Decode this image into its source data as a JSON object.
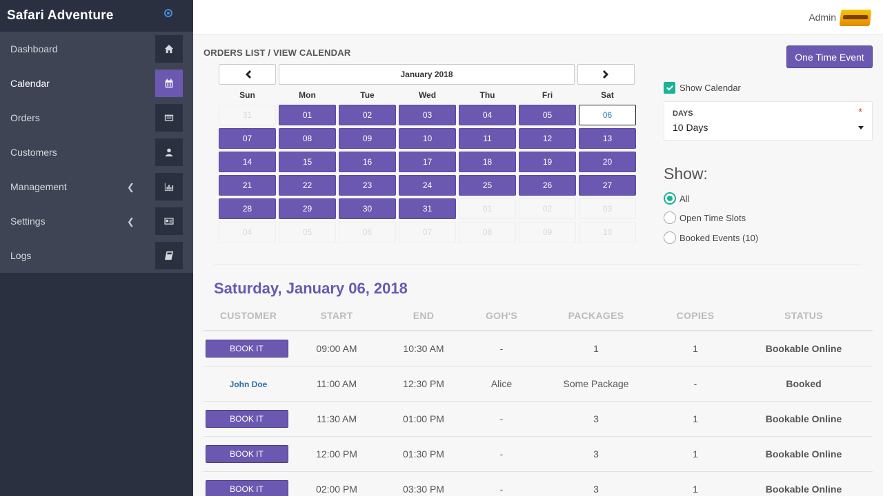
{
  "app": {
    "title": "Safari Adventure"
  },
  "sidebar": {
    "items": [
      {
        "label": "Dashboard",
        "icon": "home-icon"
      },
      {
        "label": "Calendar",
        "icon": "calendar-icon",
        "active": true
      },
      {
        "label": "Orders",
        "icon": "list-icon"
      },
      {
        "label": "Customers",
        "icon": "user-icon"
      },
      {
        "label": "Management",
        "icon": "bar-chart-icon",
        "expandable": true
      },
      {
        "label": "Settings",
        "icon": "id-card-icon",
        "expandable": true
      },
      {
        "label": "Logs",
        "icon": "book-icon"
      }
    ]
  },
  "topbar": {
    "user": "Admin"
  },
  "page": {
    "breadcrumb": "ORDERS LIST / VIEW CALENDAR",
    "one_time_event": "One Time Event"
  },
  "calendar": {
    "month_label": "January 2018",
    "days_of_week": [
      "Sun",
      "Mon",
      "Tue",
      "Wed",
      "Thu",
      "Fri",
      "Sat"
    ],
    "cells": [
      [
        "31",
        "out"
      ],
      [
        "01",
        "in"
      ],
      [
        "02",
        "in"
      ],
      [
        "03",
        "in"
      ],
      [
        "04",
        "in"
      ],
      [
        "05",
        "in"
      ],
      [
        "06",
        "sel"
      ],
      [
        "07",
        "in"
      ],
      [
        "08",
        "in"
      ],
      [
        "09",
        "in"
      ],
      [
        "10",
        "in"
      ],
      [
        "11",
        "in"
      ],
      [
        "12",
        "in"
      ],
      [
        "13",
        "in"
      ],
      [
        "14",
        "in"
      ],
      [
        "15",
        "in"
      ],
      [
        "16",
        "in"
      ],
      [
        "17",
        "in"
      ],
      [
        "18",
        "in"
      ],
      [
        "19",
        "in"
      ],
      [
        "20",
        "in"
      ],
      [
        "21",
        "in"
      ],
      [
        "22",
        "in"
      ],
      [
        "23",
        "in"
      ],
      [
        "24",
        "in"
      ],
      [
        "25",
        "in"
      ],
      [
        "26",
        "in"
      ],
      [
        "27",
        "in"
      ],
      [
        "28",
        "in"
      ],
      [
        "29",
        "in"
      ],
      [
        "30",
        "in"
      ],
      [
        "31",
        "in"
      ],
      [
        "01",
        "out"
      ],
      [
        "02",
        "out"
      ],
      [
        "03",
        "out"
      ],
      [
        "04",
        "out"
      ],
      [
        "05",
        "out"
      ],
      [
        "06",
        "out"
      ],
      [
        "07",
        "out"
      ],
      [
        "08",
        "out"
      ],
      [
        "09",
        "out"
      ],
      [
        "10",
        "out"
      ]
    ]
  },
  "panel": {
    "show_calendar": "Show Calendar",
    "days_label": "DAYS",
    "days_required": "*",
    "days_value": "10 Days",
    "show_title": "Show:",
    "filters": [
      "All",
      "Open Time Slots",
      "Booked Events (10)"
    ],
    "selected_filter": "All"
  },
  "schedule": {
    "date_heading": "Saturday, January 06, 2018",
    "columns": [
      "CUSTOMER",
      "START",
      "END",
      "GOH'S",
      "PACKAGES",
      "COPIES",
      "STATUS"
    ],
    "rows": [
      {
        "customer": "BOOK IT",
        "customer_type": "button",
        "start": "09:00 AM",
        "end": "10:30 AM",
        "goh": "-",
        "packages": "1",
        "copies": "1",
        "status": "Bookable Online"
      },
      {
        "customer": "John Doe",
        "customer_type": "link",
        "start": "11:00 AM",
        "end": "12:30 PM",
        "goh": "Alice",
        "packages": "Some Package",
        "copies": "-",
        "status": "Booked"
      },
      {
        "customer": "BOOK IT",
        "customer_type": "button",
        "start": "11:30 AM",
        "end": "01:00 PM",
        "goh": "-",
        "packages": "3",
        "copies": "1",
        "status": "Bookable Online"
      },
      {
        "customer": "BOOK IT",
        "customer_type": "button",
        "start": "12:00 PM",
        "end": "01:30 PM",
        "goh": "-",
        "packages": "3",
        "copies": "1",
        "status": "Bookable Online"
      },
      {
        "customer": "BOOK IT",
        "customer_type": "button",
        "start": "02:00 PM",
        "end": "03:30 PM",
        "goh": "-",
        "packages": "3",
        "copies": "1",
        "status": "Bookable Online"
      }
    ]
  },
  "colors": {
    "accent": "#6b58b0",
    "sidebar": "#2b3040",
    "sidebar_menu": "#3e4454",
    "teal": "#1ab394",
    "link": "#2b7bc4"
  }
}
